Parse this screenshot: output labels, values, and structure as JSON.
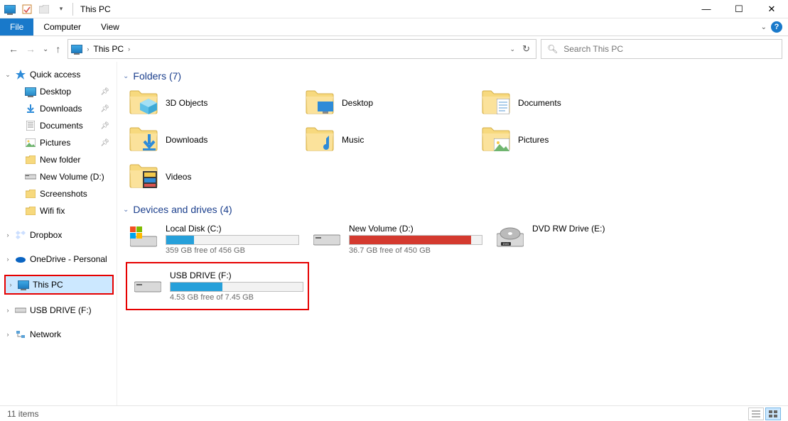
{
  "window": {
    "title": "This PC"
  },
  "ribbon": {
    "file": "File",
    "computer": "Computer",
    "view": "View"
  },
  "address": {
    "location": "This PC"
  },
  "search": {
    "placeholder": "Search This PC"
  },
  "sidebar": {
    "quickaccess": {
      "label": "Quick access"
    },
    "qitems": [
      {
        "label": "Desktop",
        "pin": true
      },
      {
        "label": "Downloads",
        "pin": true
      },
      {
        "label": "Documents",
        "pin": true
      },
      {
        "label": "Pictures",
        "pin": true
      },
      {
        "label": "New folder",
        "pin": false
      },
      {
        "label": "New Volume (D:)",
        "pin": false
      },
      {
        "label": "Screenshots",
        "pin": false
      },
      {
        "label": "Wifi fix",
        "pin": false
      }
    ],
    "dropbox": {
      "label": "Dropbox"
    },
    "onedrive": {
      "label": "OneDrive - Personal"
    },
    "thispc": {
      "label": "This PC"
    },
    "usb": {
      "label": "USB DRIVE (F:)"
    },
    "network": {
      "label": "Network"
    }
  },
  "groups": {
    "folders": {
      "title": "Folders (7)"
    },
    "drives": {
      "title": "Devices and drives (4)"
    }
  },
  "folders": [
    {
      "name": "3D Objects"
    },
    {
      "name": "Desktop"
    },
    {
      "name": "Documents"
    },
    {
      "name": "Downloads"
    },
    {
      "name": "Music"
    },
    {
      "name": "Pictures"
    },
    {
      "name": "Videos"
    }
  ],
  "drives": [
    {
      "name": "Local Disk (C:)",
      "free": "359 GB free of 456 GB",
      "fillPct": 21,
      "color": "#26a0da"
    },
    {
      "name": "New Volume (D:)",
      "free": "36.7 GB free of 450 GB",
      "fillPct": 92,
      "color": "#d43a2f"
    },
    {
      "name": "DVD RW Drive (E:)",
      "free": "",
      "fillPct": 0,
      "color": "",
      "nobar": true
    },
    {
      "name": "USB DRIVE (F:)",
      "free": "4.53 GB free of 7.45 GB",
      "fillPct": 39,
      "color": "#26a0da",
      "highlight": true
    }
  ],
  "status": {
    "items": "11 items"
  }
}
